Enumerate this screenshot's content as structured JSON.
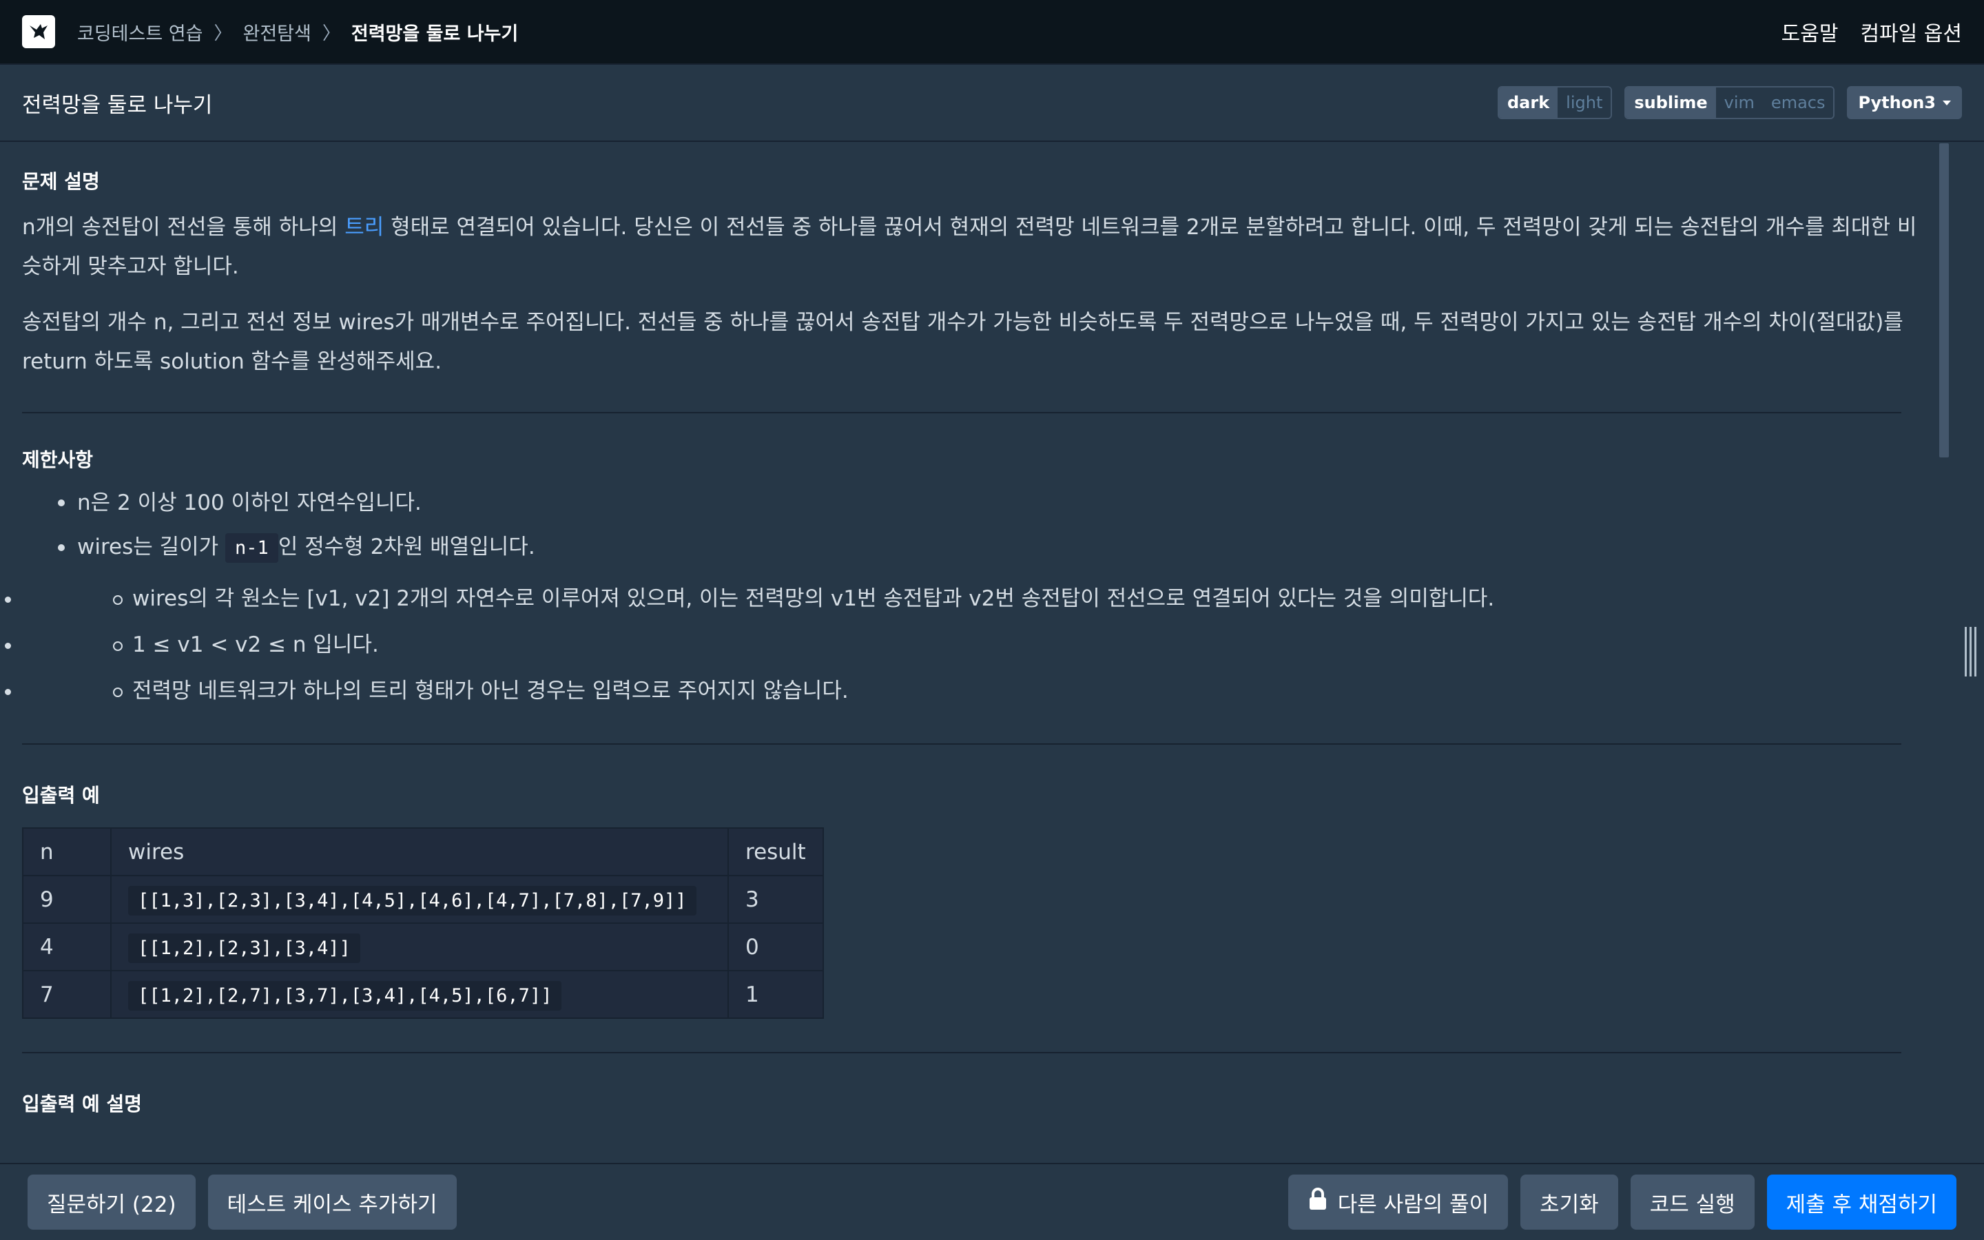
{
  "nav": {
    "breadcrumb": [
      "코딩테스트 연습",
      "완전탐색",
      "전력망을 둘로 나누기"
    ],
    "help": "도움말",
    "compile_options": "컴파일 옵션"
  },
  "titlebar": {
    "title": "전력망을 둘로 나누기",
    "theme": {
      "dark": "dark",
      "light": "light"
    },
    "keymap": {
      "sublime": "sublime",
      "vim": "vim",
      "emacs": "emacs"
    },
    "language": "Python3"
  },
  "description": {
    "title": "문제 설명",
    "p1_before": "n개의 송전탑이 전선을 통해 하나의 ",
    "p1_link": "트리",
    "p1_after": " 형태로 연결되어 있습니다. 당신은 이 전선들 중 하나를 끊어서 현재의 전력망 네트워크를 2개로 분할하려고 합니다. 이때, 두 전력망이 갖게 되는 송전탑의 개수를 최대한 비슷하게 맞추고자 합니다.",
    "p2": "송전탑의 개수 n, 그리고 전선 정보 wires가 매개변수로 주어집니다. 전선들 중 하나를 끊어서 송전탑 개수가 가능한 비슷하도록 두 전력망으로 나누었을 때, 두 전력망이 가지고 있는 송전탑 개수의 차이(절대값)를 return 하도록 solution 함수를 완성해주세요."
  },
  "constraints": {
    "title": "제한사항",
    "item1": "n은 2 이상 100 이하인 자연수입니다.",
    "item2_before": "wires는 길이가 ",
    "item2_code": "n-1",
    "item2_after": "인 정수형 2차원 배열입니다.",
    "sub": [
      "wires의 각 원소는 [v1, v2] 2개의 자연수로 이루어져 있으며, 이는 전력망의 v1번 송전탑과 v2번 송전탑이 전선으로 연결되어 있다는 것을 의미합니다.",
      "1 ≤ v1 < v2 ≤ n 입니다.",
      "전력망 네트워크가 하나의 트리 형태가 아닌 경우는 입력으로 주어지지 않습니다."
    ]
  },
  "examples": {
    "title": "입출력 예",
    "headers": [
      "n",
      "wires",
      "result"
    ],
    "rows": [
      [
        "9",
        "[[1,3],[2,3],[3,4],[4,5],[4,6],[4,7],[7,8],[7,9]]",
        "3"
      ],
      [
        "4",
        "[[1,2],[2,3],[3,4]]",
        "0"
      ],
      [
        "7",
        "[[1,2],[2,7],[3,7],[3,4],[4,5],[6,7]]",
        "1"
      ]
    ]
  },
  "examples_explain": {
    "title": "입출력 예 설명"
  },
  "bottom": {
    "ask": "질문하기 (22)",
    "add_test": "테스트 케이스 추가하기",
    "others": "다른 사람의 풀이",
    "reset": "초기화",
    "run": "코드 실행",
    "submit": "제출 후 채점하기"
  },
  "colors": {
    "background": "#263747",
    "nav": "#0c151c",
    "primary": "#0078ff",
    "link": "#4a9eff"
  }
}
